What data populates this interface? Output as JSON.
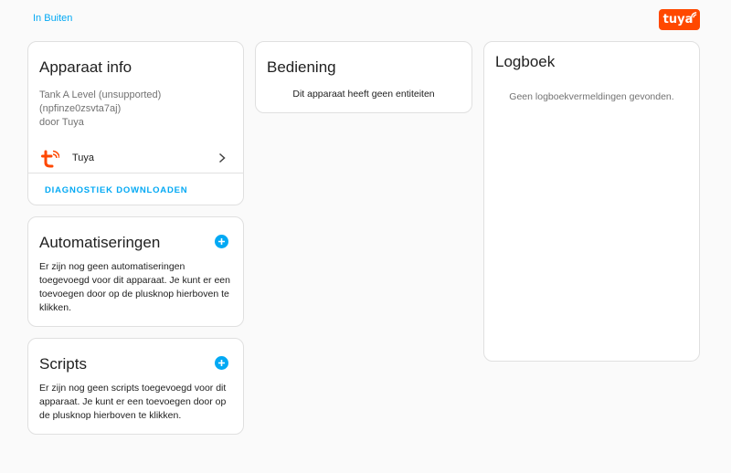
{
  "breadcrumb": {
    "area_link": "In Buiten"
  },
  "brand": {
    "logo_text": "tuya",
    "color": "#ff4800"
  },
  "device_info": {
    "title": "Apparaat info",
    "lines": [
      "Tank A Level (unsupported)",
      "(npfinze0zsvta7aj)",
      "door Tuya"
    ],
    "integration_label": "Tuya",
    "download_button": "DIAGNOSTIEK DOWNLOADEN"
  },
  "automations": {
    "title": "Automatiseringen",
    "body": "Er zijn nog geen automatiseringen toegevoegd voor dit apparaat. Je kunt er een toevoegen door op de plusknop hierboven te klikken."
  },
  "scripts": {
    "title": "Scripts",
    "body": "Er zijn nog geen scripts toegevoegd voor dit apparaat. Je kunt er een toevoegen door op de plusknop hierboven te klikken."
  },
  "controls": {
    "title": "Bediening",
    "empty_text": "Dit apparaat heeft geen entiteiten"
  },
  "logbook": {
    "title": "Logboek",
    "empty_text": "Geen logboekvermeldingen gevonden."
  },
  "colors": {
    "accent": "#03a9f4",
    "brand": "#ff4800",
    "card_border": "#e0e0e0",
    "background": "#fafafa",
    "secondary_text": "#727272"
  },
  "icons": {
    "integration": "tuya-logo-icon",
    "row_chevron": "chevron-right-icon",
    "add": "plus-circle-icon"
  }
}
